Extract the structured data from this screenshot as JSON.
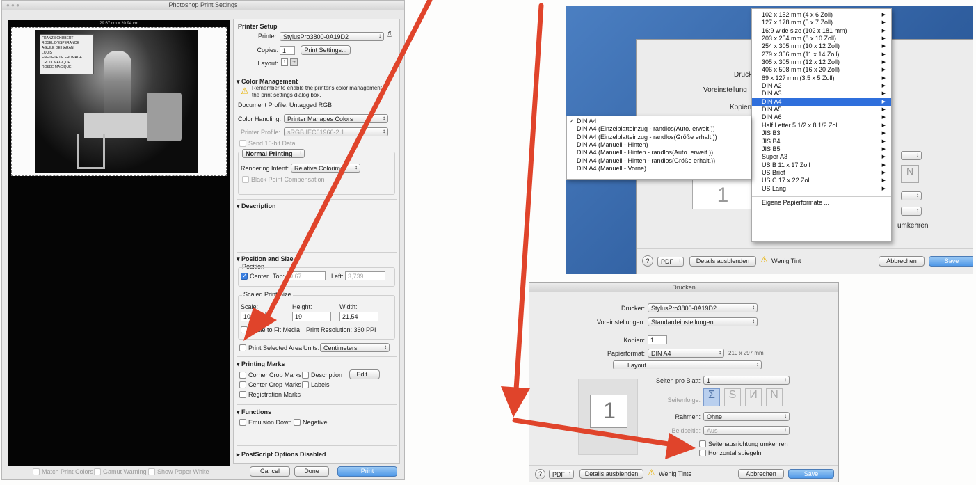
{
  "colors": {
    "accent": "#2f6fdc",
    "arrow": "#e0442b",
    "desktop_blue": "#3c6fb4"
  },
  "ps": {
    "title": "Photoshop Print Settings",
    "preview_dims": "29.67 cm x 20.94 cm",
    "printer_setup": {
      "heading": "Printer Setup",
      "printer_label": "Printer:",
      "printer_value": "StylusPro3800-0A19D2",
      "copies_label": "Copies:",
      "copies_value": "1",
      "print_settings_button": "Print Settings...",
      "layout_label": "Layout:"
    },
    "color_mgmt": {
      "heading": "▾ Color Management",
      "warning": "Remember to enable the printer's color management in the print settings dialog box.",
      "doc_profile": "Document Profile: Untagged RGB",
      "handling_label": "Color Handling:",
      "handling_value": "Printer Manages Colors",
      "profile_label": "Printer Profile:",
      "profile_value": "sRGB IEC61966-2.1",
      "send16": "Send 16-bit Data",
      "normal_printing": "Normal Printing",
      "intent_label": "Rendering Intent:",
      "intent_value": "Relative Colorimet",
      "black_point": "Black Point Compensation"
    },
    "description": {
      "heading": "▾ Description"
    },
    "position": {
      "heading": "▾ Position and Size",
      "position_label": "Position",
      "center": "Center",
      "top_label": "Top:",
      "top_value": "0,67",
      "left_label": "Left:",
      "left_value": "3,739",
      "scaled_label": "Scaled Print Size",
      "scale_label": "Scale:",
      "scale_value": "100",
      "height_label": "Height:",
      "height_value": "19",
      "width_label": "Width:",
      "width_value": "21,54",
      "scale_to_fit": "Scale to Fit Media",
      "resolution": "Print Resolution: 360 PPI",
      "print_selected": "Print Selected Area",
      "units_label": "Units:",
      "units_value": "Centimeters"
    },
    "marks": {
      "heading": "▾ Printing Marks",
      "corner": "Corner Crop Marks",
      "center": "Center Crop Marks",
      "registration": "Registration Marks",
      "description": "Description",
      "labels": "Labels",
      "edit_button": "Edit..."
    },
    "functions": {
      "heading": "▾ Functions",
      "emulsion": "Emulsion Down",
      "negative": "Negative"
    },
    "postscript": {
      "heading": "▸ PostScript Options Disabled"
    },
    "bottom": {
      "match": "Match Print Colors",
      "gamut": "Gamut Warning",
      "paper_white": "Show Paper White",
      "cancel": "Cancel",
      "done": "Done",
      "print": "Print"
    },
    "image_sign": [
      "FRANZ SCHUBERT",
      "ROSEL D'ESPERANCE",
      "AGUILE DE HARAN",
      "LOUIS",
      "ENFILETE LE FROMAGE",
      "CROIX MAGIQUE",
      "ROSEE MAGIQUE"
    ]
  },
  "top_right": {
    "bg_dialog": {
      "drucker": "Drucker",
      "voreinstellungen": "Voreinstellung",
      "kopien": "Kopien",
      "umkehren": "umkehren",
      "pdf": "PDF",
      "details": "Details ausblenden",
      "wenig_tinte": "Wenig Tint",
      "abbrechen": "Abbrechen",
      "save": "Save"
    },
    "paper_sizes": [
      "102 x 152 mm (4 x 6 Zoll)",
      "127 x 178 mm (5 x 7 Zoll)",
      "16:9 wide size (102 x 181 mm)",
      "203 x 254 mm (8 x 10 Zoll)",
      "254 x 305 mm (10 x 12 Zoll)",
      "279 x 356 mm (11 x 14 Zoll)",
      "305 x 305 mm (12 x 12 Zoll)",
      "406 x 508 mm (16 x 20 Zoll)",
      "89 x 127 mm (3.5 x 5 Zoll)",
      "DIN A2",
      "DIN A3",
      "DIN A4",
      "DIN A5",
      "DIN A6",
      "Half Letter 5 1/2 x 8 1/2 Zoll",
      "JIS B3",
      "JIS B4",
      "JIS B5",
      "Super A3",
      "US B 11 x 17 Zoll",
      "US Brief",
      "US C 17 x 22 Zoll",
      "US Lang"
    ],
    "custom_sizes": "Eigene Papierformate ...",
    "a4_variants": [
      "DIN A4",
      "DIN A4 (Einzelblatteinzug - randlos(Auto. erweit.))",
      "DIN A4 (Einzelblatteinzug - randlos(Größe erhalt.))",
      "DIN A4 (Manuell - Hinten)",
      "DIN A4 (Manuell - Hinten - randlos(Auto. erweit.))",
      "DIN A4 (Manuell - Hinten - randlos(Größe erhalt.))",
      "DIN A4 (Manuell - Vorne)"
    ]
  },
  "drucken": {
    "title": "Drucken",
    "printer_label": "Drucker:",
    "printer_value": "StylusPro3800-0A19D2",
    "presets_label": "Voreinstellungen:",
    "presets_value": "Standardeinstellungen",
    "copies_label": "Kopien:",
    "copies_value": "1",
    "paper_label": "Papierformat:",
    "paper_value": "DIN A4",
    "paper_dims": "210 x 297 mm",
    "section": "Layout",
    "page_number": "1",
    "pages_label": "Seiten pro Blatt:",
    "pages_value": "1",
    "order_label": "Seitenfolge:",
    "border_label": "Rahmen:",
    "border_value": "Ohne",
    "duplex_label": "Beidseitig:",
    "duplex_value": "Aus",
    "reverse": "Seitenausrichtung umkehren",
    "flip": "Horizontal spiegeln",
    "help": "?",
    "pdf": "PDF",
    "details": "Details ausblenden",
    "warning": "Wenig Tinte",
    "cancel": "Abbrechen",
    "save": "Save"
  }
}
